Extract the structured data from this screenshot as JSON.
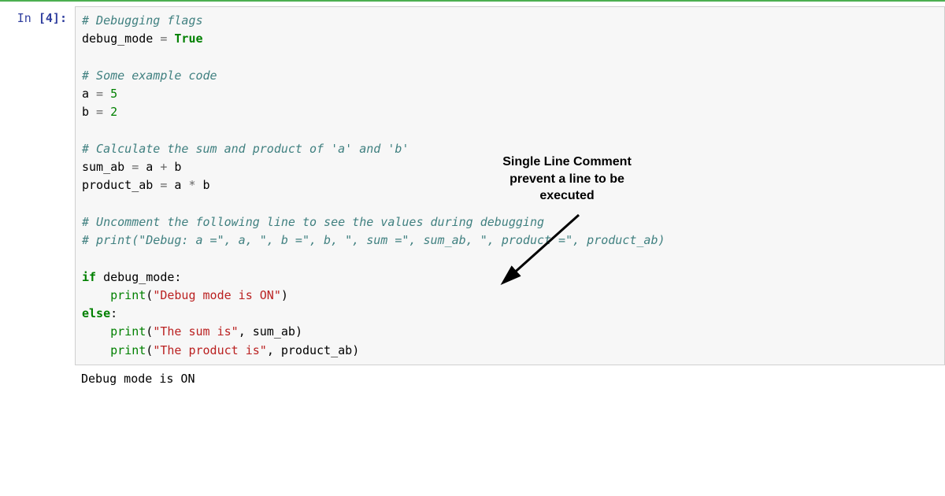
{
  "prompt": {
    "in": "In ",
    "num": "[4]:",
    "full": "In [4]:"
  },
  "code": {
    "l1_comment": "# Debugging flags",
    "l2_name": "debug_mode",
    "l2_op": " = ",
    "l2_val": "True",
    "l4_comment": "# Some example code",
    "l5": "a = 5",
    "l5_name": "a",
    "l5_op": " = ",
    "l5_val": "5",
    "l6_name": "b",
    "l6_op": " = ",
    "l6_val": "2",
    "l8_comment": "# Calculate the sum and product of 'a' and 'b'",
    "l9_name": "sum_ab",
    "l9_op": " = ",
    "l9_rhs_a": "a",
    "l9_rhs_op": " + ",
    "l9_rhs_b": "b",
    "l10_name": "product_ab",
    "l10_op": " = ",
    "l10_rhs_a": "a",
    "l10_rhs_op": " * ",
    "l10_rhs_b": "b",
    "l12_comment": "# Uncomment the following line to see the values during debugging",
    "l13_comment": "# print(\"Debug: a =\", a, \", b =\", b, \", sum =\", sum_ab, \", product =\", product_ab)",
    "l15_if": "if",
    "l15_sp": " ",
    "l15_cond": "debug_mode",
    "l15_colon": ":",
    "l16_indent": "    ",
    "l16_fn": "print",
    "l16_open": "(",
    "l16_str": "\"Debug mode is ON\"",
    "l16_close": ")",
    "l17_else": "else",
    "l17_colon": ":",
    "l18_indent": "    ",
    "l18_fn": "print",
    "l18_open": "(",
    "l18_s1": "\"The sum is\"",
    "l18_comma": ", ",
    "l18_arg": "sum_ab",
    "l18_close": ")",
    "l19_indent": "    ",
    "l19_fn": "print",
    "l19_open": "(",
    "l19_s1": "\"The product is\"",
    "l19_comma": ", ",
    "l19_arg": "product_ab",
    "l19_close": ")"
  },
  "output": "Debug mode is ON",
  "annotation": {
    "line1": "Single Line Comment",
    "line2": "prevent a line to be",
    "line3": "executed"
  }
}
